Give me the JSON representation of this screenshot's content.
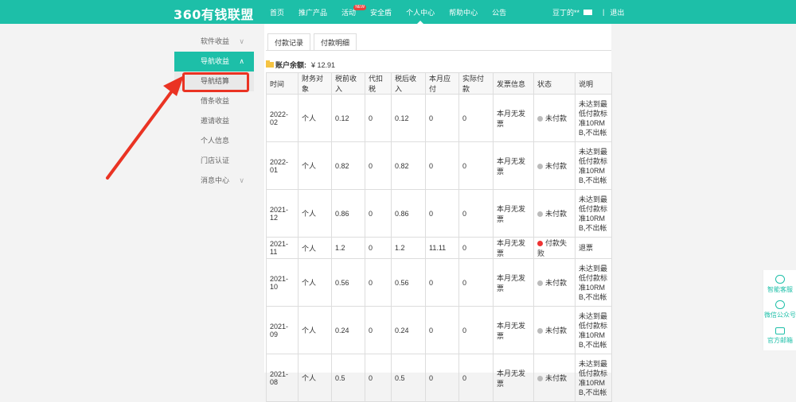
{
  "brand": "360有钱联盟",
  "nav": [
    {
      "label": "首页"
    },
    {
      "label": "推广产品"
    },
    {
      "label": "活动"
    },
    {
      "label": "安全盾"
    },
    {
      "label": "个人中心"
    },
    {
      "label": "帮助中心"
    },
    {
      "label": "公告"
    }
  ],
  "nav_badge": "NEW",
  "user": {
    "name": "豆丁的**",
    "separator": "|",
    "logout": "退出"
  },
  "sidebar": [
    {
      "label": "软件收益",
      "chevron": "∨"
    },
    {
      "label": "导航收益",
      "chevron": "∧"
    },
    {
      "label": "导航结算"
    },
    {
      "label": "借条收益"
    },
    {
      "label": "邀请收益"
    },
    {
      "label": "个人信息"
    },
    {
      "label": "门店认证"
    },
    {
      "label": "消息中心",
      "chevron": "∨"
    }
  ],
  "tabs": [
    {
      "label": "付款记录"
    },
    {
      "label": "付款明细"
    }
  ],
  "balance": {
    "label": "账户余额:",
    "value": "¥ 12.91"
  },
  "table": {
    "headers": [
      "时间",
      "财务对象",
      "税前收入",
      "代扣税",
      "税后收入",
      "本月应付",
      "实际付款",
      "发票信息",
      "状态",
      "说明"
    ],
    "rows": [
      [
        "2022-02",
        "个人",
        "0.12",
        "0",
        "0.12",
        "0",
        "0",
        "本月无发票",
        "未付款",
        "未达到最低付款标准10RMB,不出帐"
      ],
      [
        "2022-01",
        "个人",
        "0.82",
        "0",
        "0.82",
        "0",
        "0",
        "本月无发票",
        "未付款",
        "未达到最低付款标准10RMB,不出帐"
      ],
      [
        "2021-12",
        "个人",
        "0.86",
        "0",
        "0.86",
        "0",
        "0",
        "本月无发票",
        "未付款",
        "未达到最低付款标准10RMB,不出帐"
      ],
      [
        "2021-11",
        "个人",
        "1.2",
        "0",
        "1.2",
        "11.11",
        "0",
        "本月无发票",
        "付款失败",
        "退票"
      ],
      [
        "2021-10",
        "个人",
        "0.56",
        "0",
        "0.56",
        "0",
        "0",
        "本月无发票",
        "未付款",
        "未达到最低付款标准10RMB,不出帐"
      ],
      [
        "2021-09",
        "个人",
        "0.24",
        "0",
        "0.24",
        "0",
        "0",
        "本月无发票",
        "未付款",
        "未达到最低付款标准10RMB,不出帐"
      ],
      [
        "2021-08",
        "个人",
        "0.5",
        "0",
        "0.5",
        "0",
        "0",
        "本月无发票",
        "未付款",
        "未达到最低付款标准10RMB,不出帐"
      ]
    ]
  },
  "right_bar": [
    {
      "label": "智能客服"
    },
    {
      "label": "微信公众号"
    },
    {
      "label": "官方邮箱"
    }
  ],
  "colors": {
    "brand": "#1dbfa8",
    "highlight": "#ea3323",
    "status_fail": "#e33333",
    "status_unpaid": "#bbbbbb"
  }
}
